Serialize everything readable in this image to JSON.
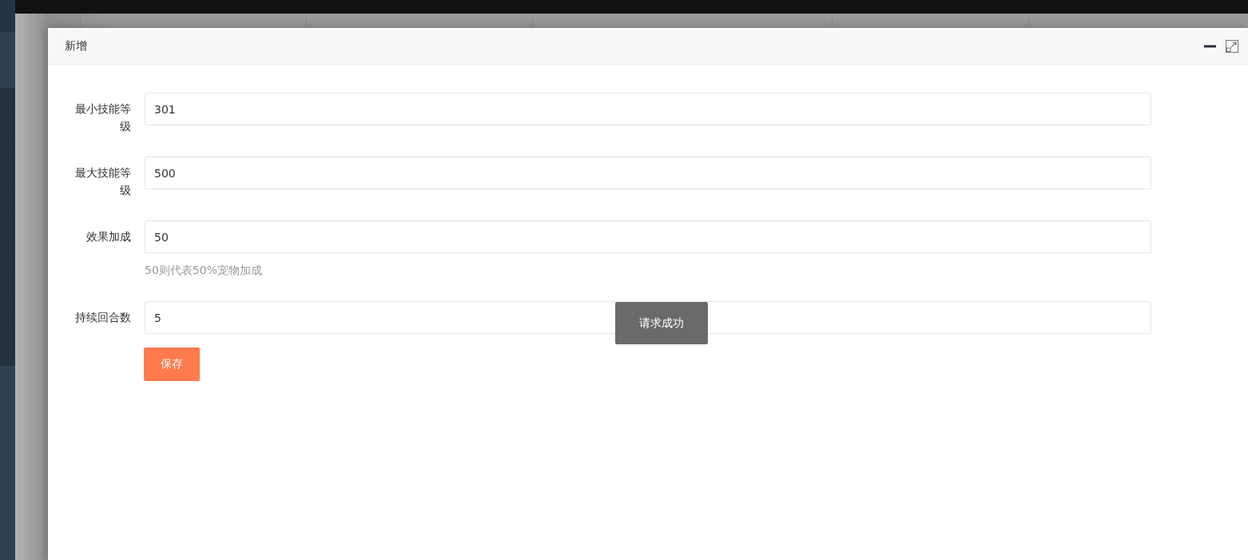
{
  "dialog": {
    "title": "新增"
  },
  "fields": [
    {
      "label": "最小技能等级",
      "value": "301"
    },
    {
      "label": "最大技能等级",
      "value": "500"
    },
    {
      "label": "效果加成",
      "value": "50",
      "hint": "50则代表50%宠物加成"
    },
    {
      "label": "持续回合数",
      "value": "5"
    }
  ],
  "save_button": "保存",
  "toast": "请求成功"
}
